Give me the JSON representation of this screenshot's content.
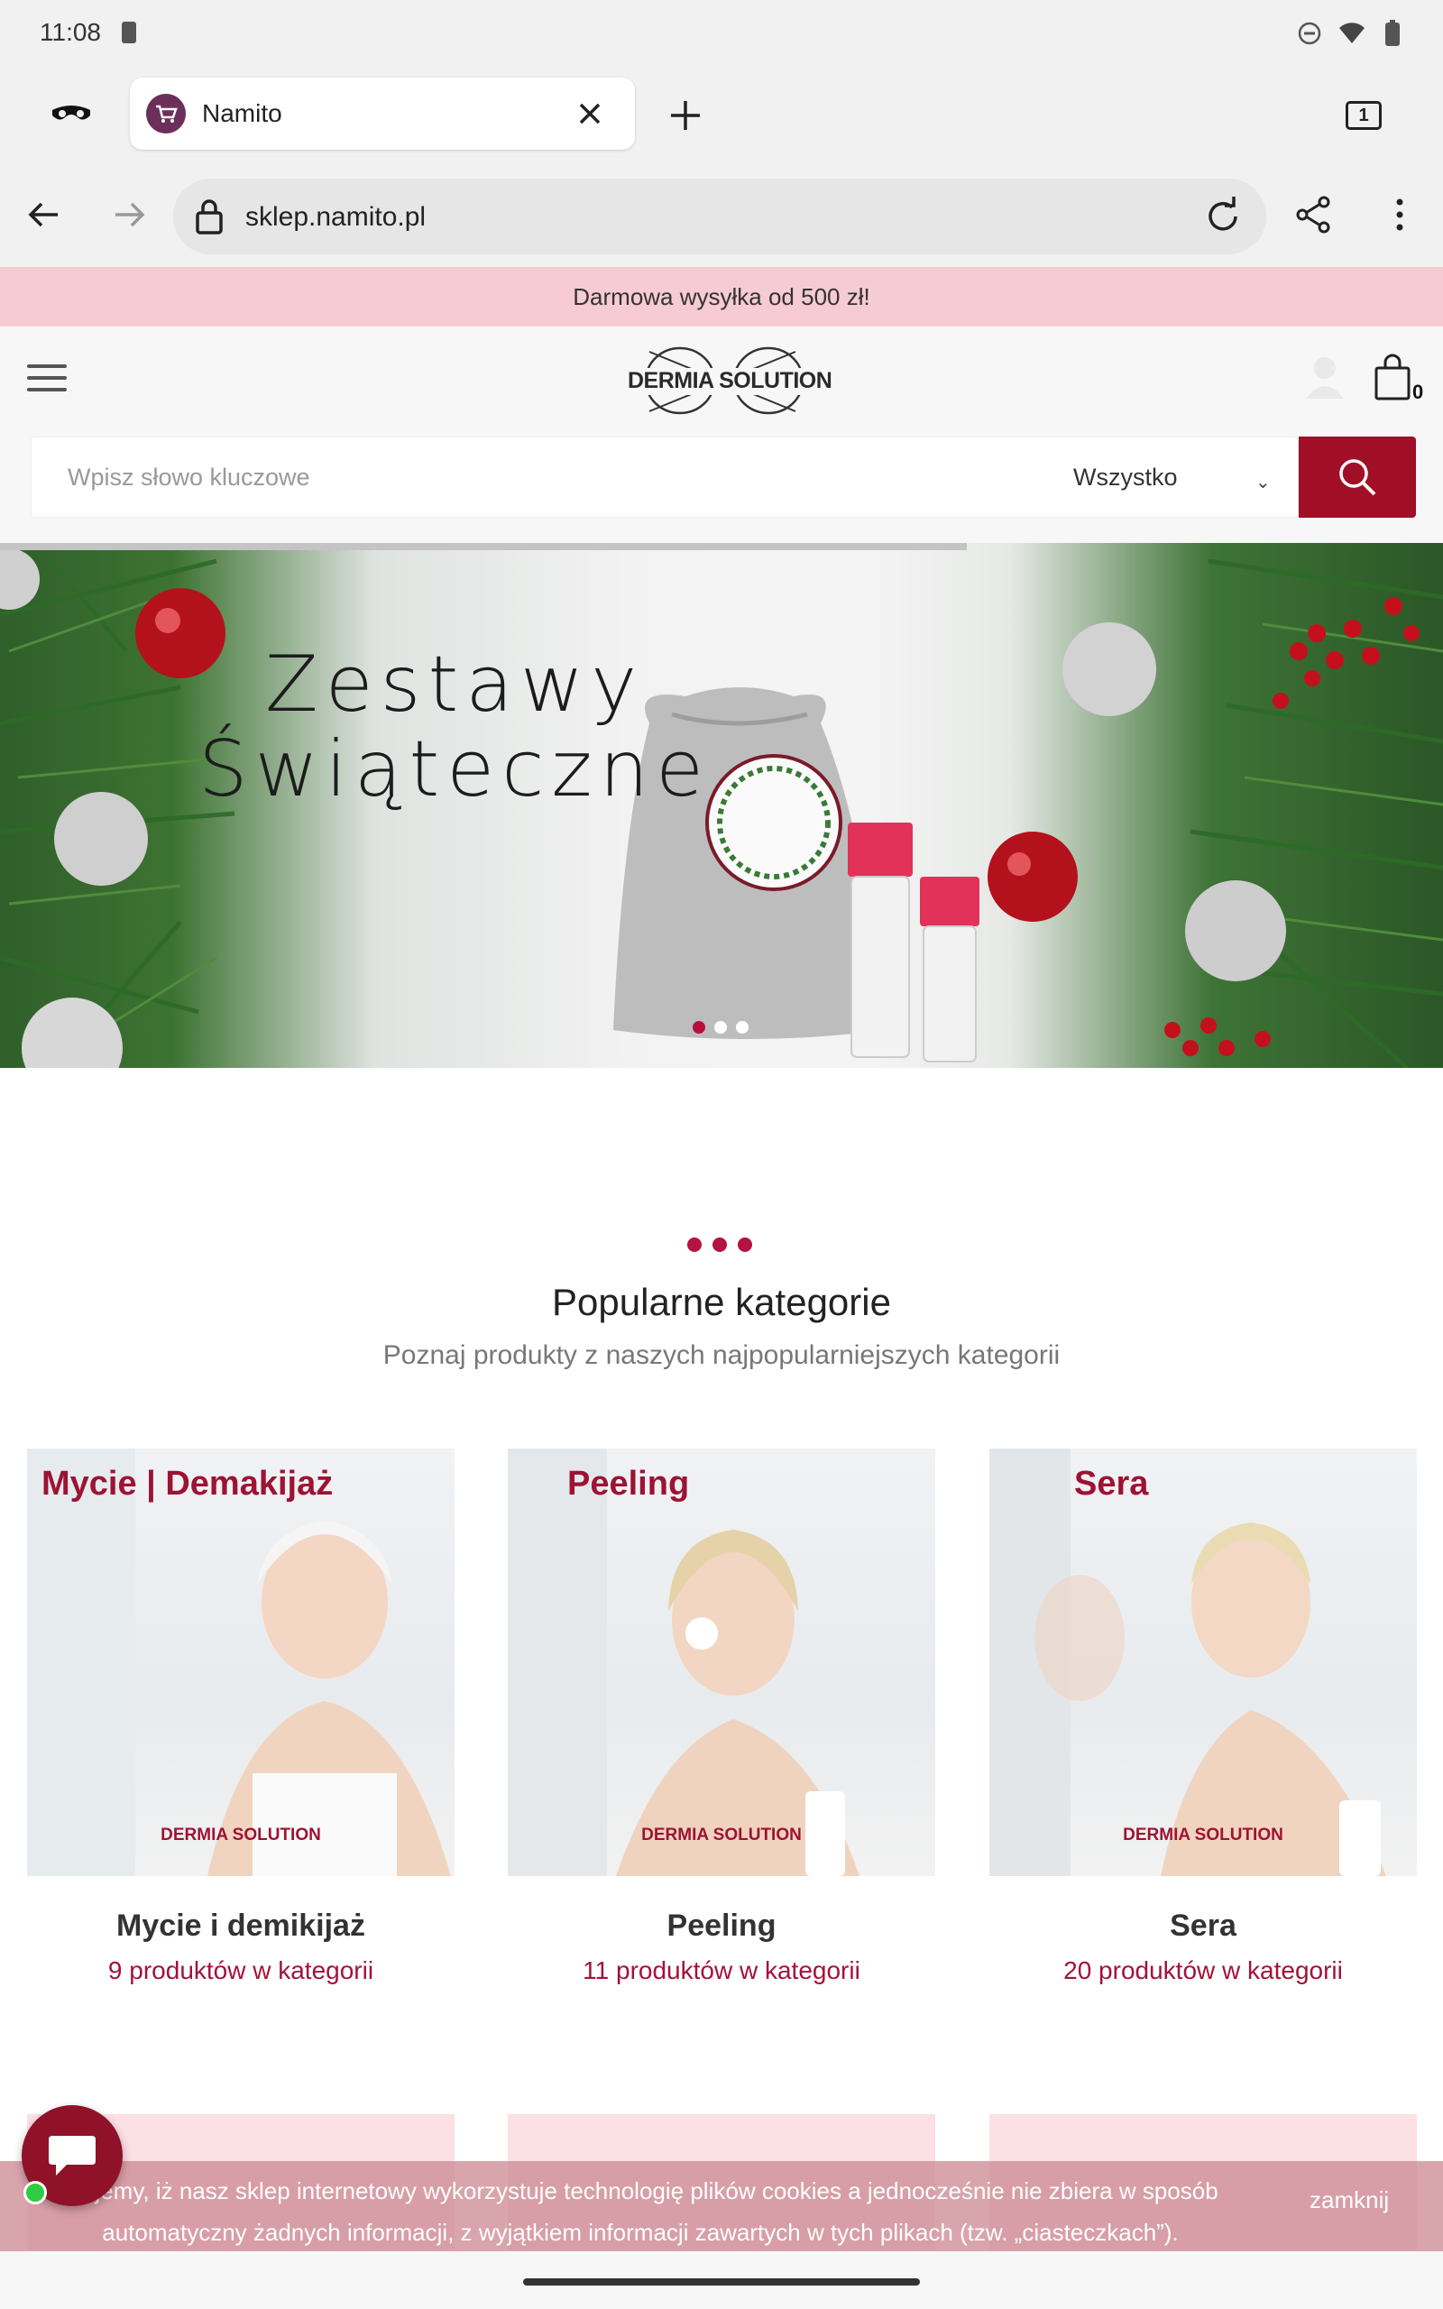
{
  "status_bar": {
    "time": "11:08"
  },
  "browser": {
    "tab_title": "Namito",
    "tab_count": "1",
    "url": "sklep.namito.pl"
  },
  "promo": {
    "text": "Darmowa wysyłka od 500 zł!"
  },
  "header": {
    "logo_text": "DERMIA SOLUTION",
    "cart_count": "0"
  },
  "search": {
    "placeholder": "Wpisz słowo kluczowe",
    "category": "Wszystko"
  },
  "hero": {
    "title_line1": "Zestawy",
    "title_line2": "Świąteczne",
    "slide_count": 3,
    "active_slide": 1
  },
  "popular": {
    "title": "Popularne kategorie",
    "subtitle": "Poznaj produkty z naszych najpopularniejszych kategorii",
    "cards": [
      {
        "label": "Mycie | Demakijaż",
        "brand": "DERMIA SOLUTION",
        "name": "Mycie i demikijaż",
        "count": "9 produktów w kategorii"
      },
      {
        "label": "Peeling",
        "brand": "DERMIA SOLUTION",
        "name": "Peeling",
        "count": "11 produktów w kategorii"
      },
      {
        "label": "Sera",
        "brand": "DERMIA SOLUTION",
        "name": "Sera",
        "count": "20 produktów w kategorii"
      }
    ]
  },
  "cookie": {
    "text": "...ujemy, iż nasz sklep internetowy wykorzystuje technologię plików cookies a jednocześnie nie zbiera w sposób automatyczny żadnych informacji, z wyjątkiem informacji zawartych w tych plikach (tzw. „ciasteczkach”).",
    "close": "zamknij"
  },
  "colors": {
    "accent": "#a00f26",
    "promo_bg": "#f6cbd4",
    "brand_text": "#9c1333"
  }
}
